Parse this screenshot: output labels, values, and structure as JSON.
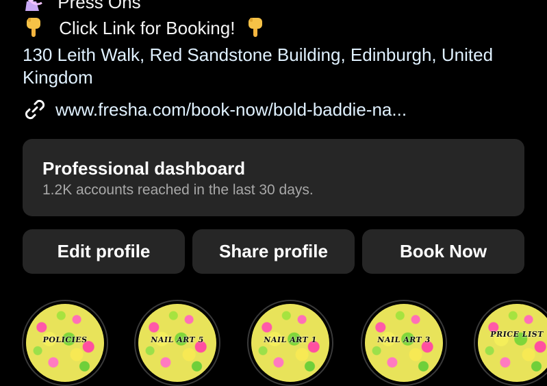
{
  "bio": {
    "line1": "Press Ons",
    "line2": "Click Link for Booking!",
    "address": "130 Leith Walk, Red Sandstone Building, Edinburgh, United Kingdom",
    "link": "www.fresha.com/book-now/bold-baddie-na..."
  },
  "dashboard": {
    "title": "Professional dashboard",
    "subtitle": "1.2K accounts reached in the last 30 days."
  },
  "buttons": {
    "edit": "Edit profile",
    "share": "Share profile",
    "book": "Book Now"
  },
  "highlights": [
    {
      "label": "POLICIES"
    },
    {
      "label": "NAIL ART 5"
    },
    {
      "label": "NAIL ART 1"
    },
    {
      "label": "NAIL ART 3"
    },
    {
      "label": "PRICE LIST"
    }
  ],
  "icons": {
    "nail_polish": "nail-polish-emoji",
    "pointing_down": "backhand-index-pointing-down-emoji",
    "link": "link-icon"
  },
  "colors": {
    "background": "#000000",
    "card": "#262626",
    "link_text": "#e0f1ff",
    "muted_text": "#a8a8a8"
  }
}
